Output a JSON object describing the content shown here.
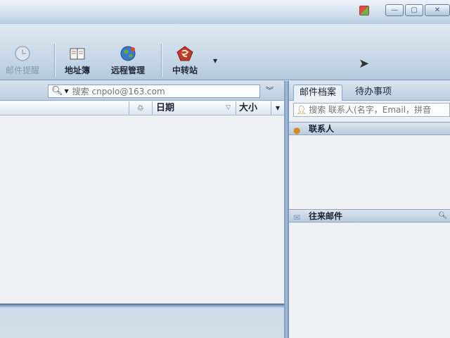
{
  "window": {
    "controls": [
      "—",
      "▢",
      "✕"
    ]
  },
  "toolbar": {
    "items": [
      {
        "label": "邮件提醒",
        "icon": "clock-icon",
        "enabled": false
      },
      {
        "label": "地址簿",
        "icon": "address-book-icon",
        "enabled": true
      },
      {
        "label": "远程管理",
        "icon": "globe-icon",
        "enabled": true
      },
      {
        "label": "中转站",
        "icon": "transfer-station-icon",
        "enabled": true
      }
    ]
  },
  "mail_search": {
    "placeholder": "搜索 cnpolo@163.com"
  },
  "mail_list": {
    "columns": {
      "date": "日期",
      "size": "大小"
    }
  },
  "side_panel": {
    "tabs": [
      "邮件档案",
      "待办事项"
    ],
    "contact_search_placeholder": "搜索 联系人(名字，Email，拼音",
    "sections": {
      "contacts": "联系人",
      "correspondence": "往来邮件"
    }
  },
  "colors": {
    "toolbar_bg": "#c4d5e6",
    "pane_border": "#7f9dbf",
    "list_bg": "#f0f1f2"
  }
}
